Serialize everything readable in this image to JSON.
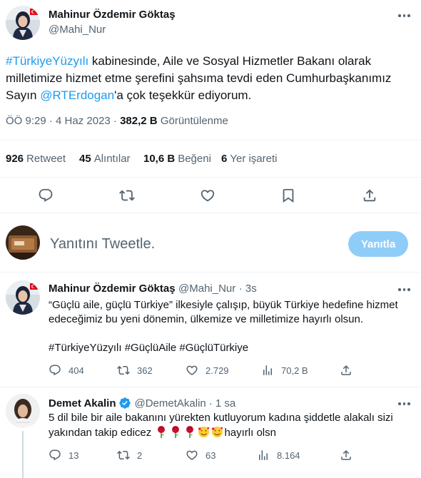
{
  "main_tweet": {
    "author_name": "Mahinur Özdemir Göktaş",
    "author_handle": "@Mahi_Nur",
    "text_hashtag": "#TürkiyeYüzyılı",
    "text_part1": " kabinesinde, Aile ve Sosyal Hizmetler Bakanı olarak milletimize hizmet etme şerefini şahsıma tevdi eden Cumhurbaşkanımız Sayın ",
    "text_mention": "@RTErdogan",
    "text_part2": "'a çok teşekkür ediyorum.",
    "timestamp": "ÖÖ 9:29 · 4 Haz 2023 ·",
    "views_count": "382,2 B",
    "views_label": "Görüntülenme",
    "stats": {
      "retweets_count": "926",
      "retweets_label": "Retweet",
      "quotes_count": "45",
      "quotes_label": "Alıntılar",
      "likes_count": "10,6 B",
      "likes_label": "Beğeni",
      "bookmarks_count": "6",
      "bookmarks_label": "Yer işareti"
    },
    "actions": [
      "reply-icon",
      "retweet-icon",
      "like-icon",
      "bookmark-icon",
      "share-icon"
    ]
  },
  "reply_composer": {
    "placeholder": "Yanıtını Tweetle.",
    "button_label": "Yanıtla",
    "button_color": "#8ecdf8"
  },
  "tweet2": {
    "author_name": "Mahinur Özdemir Göktaş",
    "author_handle": "@Mahi_Nur",
    "time": "· 3s",
    "text": "“Güçlü aile, güçlü Türkiye” ilkesiyle çalışıp, büyük Türkiye hedefine hizmet edeceğimiz bu yeni dönemin, ülkemize ve milletimize hayırlı olsun.",
    "hashtags": "#TürkiyeYüzyılı #GüçlüAile #GüçlüTürkiye",
    "replies": "404",
    "retweets": "362",
    "likes": "2.729",
    "views": "70,2 B"
  },
  "tweet3": {
    "author_name": "Demet Akalin",
    "author_handle": "@DemetAkalin",
    "time": "· 1 sa",
    "text_part1": "5 dil bile bir aile bakanını yürekten kutluyorum kadına şiddetle alakalı sizi yakından takip edicez",
    "text_part2": "hayırlı olsn",
    "replies": "13",
    "retweets": "2",
    "likes": "63",
    "views": "8.164"
  },
  "colors": {
    "accent": "#1d9bf0",
    "text": "#0f1419",
    "muted": "#536471",
    "divider": "#eff3f4"
  }
}
